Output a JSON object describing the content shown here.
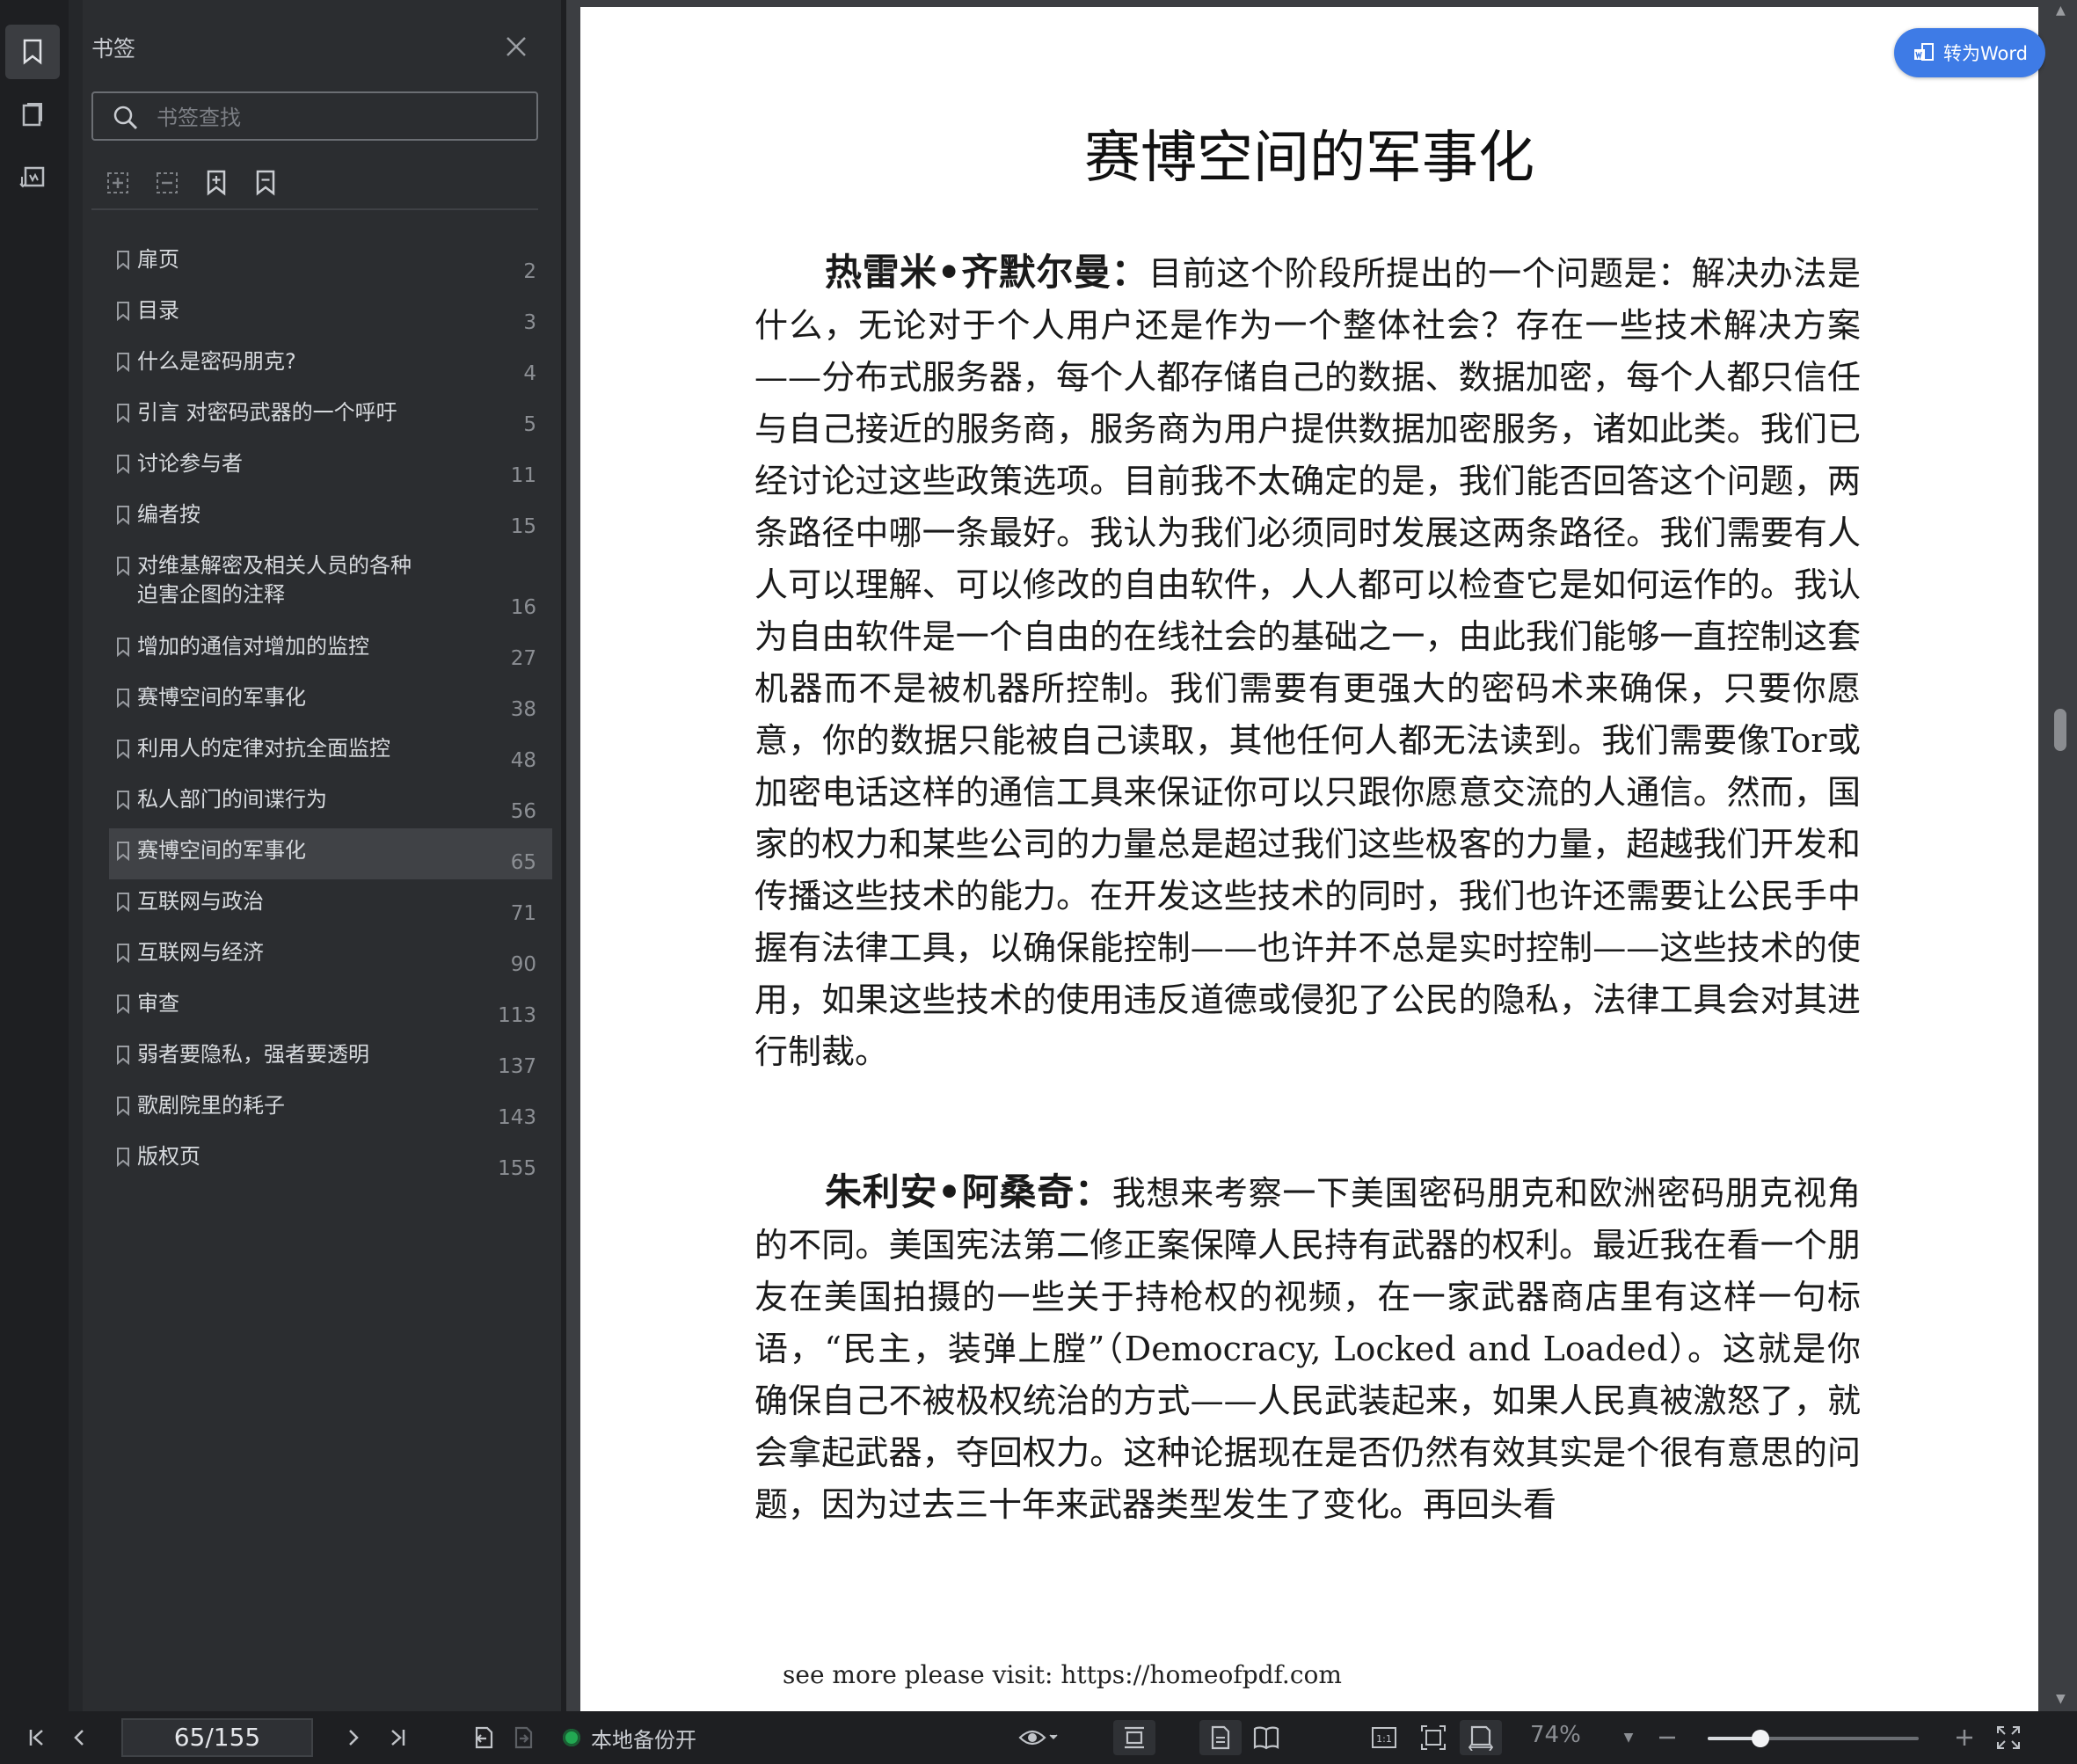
{
  "sidebar": {
    "title": "书签",
    "search_placeholder": "书签查找",
    "icons": {
      "rail": [
        "bookmark-icon",
        "thumbnail-icon",
        "annotation-icon"
      ],
      "tools": [
        "expand-all-icon",
        "collapse-all-icon",
        "add-bookmark-icon",
        "remove-bookmark-icon"
      ]
    },
    "bookmarks": [
      {
        "label": "扉页",
        "page": "2"
      },
      {
        "label": "目录",
        "page": "3"
      },
      {
        "label": "什么是密码朋克?",
        "page": "4"
      },
      {
        "label": "引言 对密码武器的一个呼吁",
        "page": "5"
      },
      {
        "label": "讨论参与者",
        "page": "11"
      },
      {
        "label": "编者按",
        "page": "15"
      },
      {
        "label": "对维基解密及相关人员的各种\n迫害企图的注释",
        "page": "16"
      },
      {
        "label": "增加的通信对增加的监控",
        "page": "27"
      },
      {
        "label": "赛博空间的军事化",
        "page": "38"
      },
      {
        "label": "利用人的定律对抗全面监控",
        "page": "48"
      },
      {
        "label": "私人部门的间谍行为",
        "page": "56"
      },
      {
        "label": "赛博空间的军事化",
        "page": "65",
        "selected": true
      },
      {
        "label": "互联网与政治",
        "page": "71"
      },
      {
        "label": "互联网与经济",
        "page": "90"
      },
      {
        "label": "审查",
        "page": "113"
      },
      {
        "label": "弱者要隐私，强者要透明",
        "page": "137"
      },
      {
        "label": "歌剧院里的耗子",
        "page": "143"
      },
      {
        "label": "版权页",
        "page": "155"
      }
    ]
  },
  "document": {
    "convert_button": "转为Word",
    "title": "赛博空间的军事化",
    "paragraphs": [
      {
        "speaker": "热雷米•齐默尔曼：",
        "text": "目前这个阶段所提出的一个问题是：解决办法是什么，无论对于个人用户还是作为一个整体社会？存在一些技术解决方案——分布式服务器，每个人都存储自己的数据、数据加密，每个人都只信任与自己接近的服务商，服务商为用户提供数据加密服务，诸如此类。我们已经讨论过这些政策选项。目前我不太确定的是，我们能否回答这个问题，两条路径中哪一条最好。我认为我们必须同时发展这两条路径。我们需要有人人可以理解、可以修改的自由软件，人人都可以检查它是如何运作的。我认为自由软件是一个自由的在线社会的基础之一，由此我们能够一直控制这套机器而不是被机器所控制。我们需要有更强大的密码术来确保，只要你愿意，你的数据只能被自己读取，其他任何人都无法读到。我们需要像Tor或加密电话这样的通信工具来保证你可以只跟你愿意交流的人通信。然而，国家的权力和某些公司的力量总是超过我们这些极客的力量，超越我们开发和传播这些技术的能力。在开发这些技术的同时，我们也许还需要让公民手中握有法律工具，以确保能控制——也许并不总是实时控制——这些技术的使用，如果这些技术的使用违反道德或侵犯了公民的隐私，法律工具会对其进行制裁。"
      },
      {
        "speaker": "朱利安•阿桑奇：",
        "text": "我想来考察一下美国密码朋克和欧洲密码朋克视角的不同。美国宪法第二修正案保障人民持有武器的权利。最近我在看一个朋友在美国拍摄的一些关于持枪权的视频，在一家武器商店里有这样一句标语，“民主，装弹上膛”（Democracy, Locked and Loaded）。这就是你确保自己不被极权统治的方式——人民武装起来，如果人民真被激怒了，就会拿起武器，夺回权力。这种论据现在是否仍然有效其实是个很有意思的问题，因为过去三十年来武器类型发生了变化。再回头看"
      }
    ],
    "footer": "see more please visit: https://homeofpdf.com"
  },
  "statusbar": {
    "page_indicator": "65/155",
    "backup_status": "本地备份开",
    "zoom": "74%",
    "zoom_fraction": 0.25,
    "accent_green": "#22a852"
  },
  "colors": {
    "accent_blue": "#3e7be6",
    "panel_bg": "#2b2d30",
    "rail_bg": "#1e1f22"
  }
}
